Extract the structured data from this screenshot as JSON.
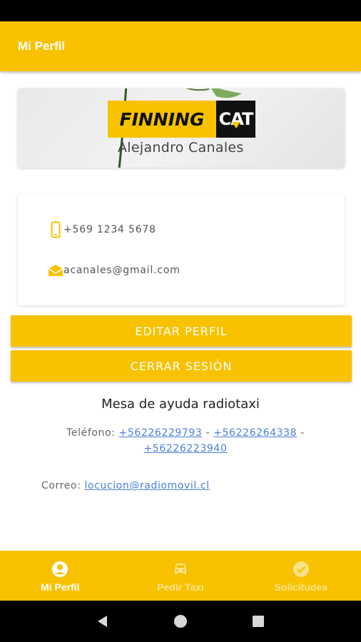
{
  "app_bar": {
    "title": "Mi Perfil"
  },
  "profile": {
    "name": "Alejandro Canales",
    "logo_text_left": "FINNING",
    "logo_text_right": "CAT",
    "phone": "+569 1234 5678",
    "email": "acanales@gmail.com"
  },
  "buttons": {
    "edit": "EDITAR PERFIL",
    "logout": "CERRAR SESIÓN"
  },
  "help": {
    "title": "Mesa de ayuda radiotaxi",
    "phone_label": "Teléfono:",
    "phones": [
      "+56226229793",
      "+56226264338",
      "+56226223940"
    ],
    "separator": "-",
    "email_label": "Correo:",
    "email": "locucion@radiomovil.cl"
  },
  "bottom_nav": {
    "items": [
      {
        "label": "Mi Perfil",
        "icon": "account-circle-icon",
        "active": true
      },
      {
        "label": "Pedir Taxi",
        "icon": "car-icon",
        "active": false
      },
      {
        "label": "Solicitudes",
        "icon": "check-circle-icon",
        "active": false
      }
    ]
  },
  "colors": {
    "accent": "#f8c200",
    "link": "#4a7fd8",
    "inactive_nav": "#fbe28a"
  }
}
